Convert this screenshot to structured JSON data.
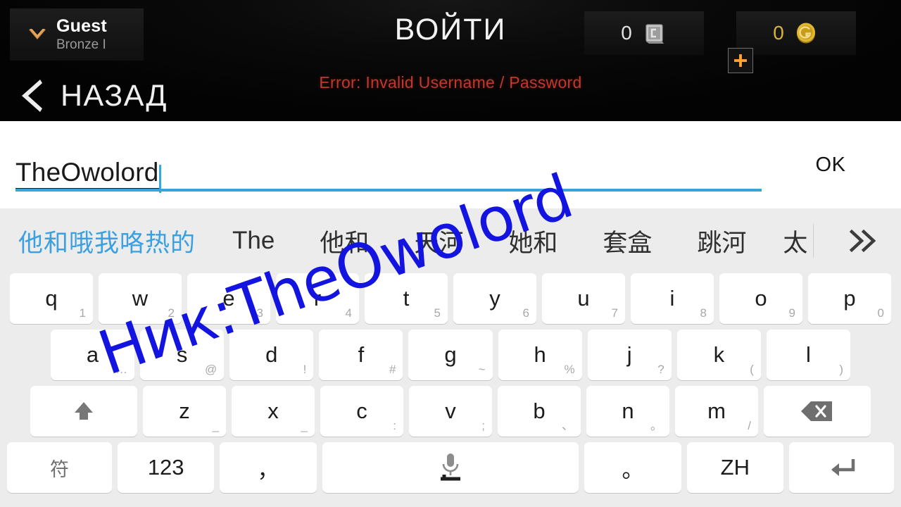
{
  "header": {
    "profile": {
      "name": "Guest",
      "rank": "Bronze I",
      "chevron_icon": "chevron-down-icon"
    },
    "title": "ВОЙТИ",
    "error": "Error: Invalid Username / Password",
    "currencies": [
      {
        "id": "silver",
        "value": "0",
        "icon": "silver-credit-icon"
      },
      {
        "id": "gold",
        "value": "0",
        "icon": "gold-coin-icon"
      }
    ],
    "plus_button": {
      "icon": "plus-icon",
      "label": "+"
    },
    "back": {
      "label": "НАЗАД",
      "icon": "chevron-left-icon"
    }
  },
  "input": {
    "value": "TheOwolord",
    "placeholder": "",
    "ok_label": "OK",
    "accent_color": "#3aa4d8"
  },
  "keyboard": {
    "suggestions": [
      {
        "text": "他和哦我咯热的",
        "primary": true
      },
      {
        "text": "The",
        "primary": false
      },
      {
        "text": "他和",
        "primary": false
      },
      {
        "text": "天河",
        "primary": false
      },
      {
        "text": "她和",
        "primary": false
      },
      {
        "text": "套盒",
        "primary": false
      },
      {
        "text": "跳河",
        "primary": false
      },
      {
        "text": "太",
        "primary": false
      }
    ],
    "expand_icon": "chevron-double-right-icon",
    "row1": [
      {
        "main": "q",
        "sub": "1"
      },
      {
        "main": "w",
        "sub": "2"
      },
      {
        "main": "e",
        "sub": "3"
      },
      {
        "main": "r",
        "sub": "4"
      },
      {
        "main": "t",
        "sub": "5"
      },
      {
        "main": "y",
        "sub": "6"
      },
      {
        "main": "u",
        "sub": "7"
      },
      {
        "main": "i",
        "sub": "8"
      },
      {
        "main": "o",
        "sub": "9"
      },
      {
        "main": "p",
        "sub": "0"
      }
    ],
    "row2": [
      {
        "main": "a",
        "sub": "…"
      },
      {
        "main": "s",
        "sub": "@"
      },
      {
        "main": "d",
        "sub": "!"
      },
      {
        "main": "f",
        "sub": "#"
      },
      {
        "main": "g",
        "sub": "~"
      },
      {
        "main": "h",
        "sub": "%"
      },
      {
        "main": "j",
        "sub": "?"
      },
      {
        "main": "k",
        "sub": "("
      },
      {
        "main": "l",
        "sub": ")"
      }
    ],
    "row3": {
      "shift": {
        "icon": "shift-arrow-icon"
      },
      "keys": [
        {
          "main": "z",
          "sub": "_"
        },
        {
          "main": "x",
          "sub": "_"
        },
        {
          "main": "c",
          "sub": ":"
        },
        {
          "main": "v",
          "sub": ";"
        },
        {
          "main": "b",
          "sub": "、"
        },
        {
          "main": "n",
          "sub": "。"
        },
        {
          "main": "m",
          "sub": "/"
        }
      ],
      "backspace": {
        "icon": "backspace-icon"
      }
    },
    "row4": {
      "symbols": {
        "label": "符"
      },
      "numbers": {
        "label": "123"
      },
      "comma": {
        "label": "，"
      },
      "space": {
        "icon": "microphone-icon",
        "label": ""
      },
      "period": {
        "label": "。"
      },
      "language": {
        "label": "ZH"
      },
      "enter": {
        "icon": "enter-arrow-icon"
      }
    }
  },
  "annotation": {
    "text": "Ник:TheOwolord",
    "color": "#1414e0"
  }
}
